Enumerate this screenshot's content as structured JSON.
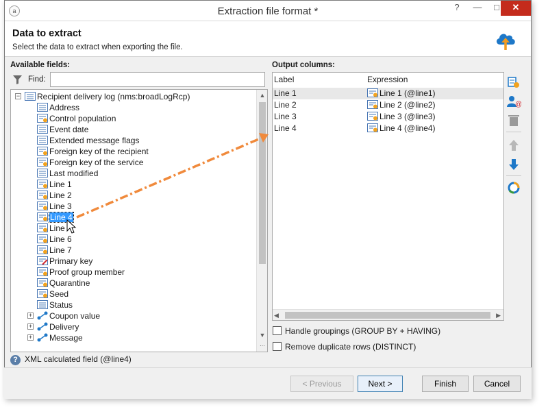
{
  "window": {
    "title": "Extraction file format *",
    "help_btn": "?",
    "close_btn": "✕"
  },
  "header": {
    "title": "Data to extract",
    "subtitle": "Select the data to extract when exporting the file.",
    "icon": "cloud-upload-icon"
  },
  "available": {
    "label": "Available fields:",
    "find_label": "Find:",
    "find_value": "",
    "tree": {
      "root": "Recipient delivery log (nms:broadLogRcp)",
      "fields": [
        "Address",
        "Control population",
        "Event date",
        "Extended message flags",
        "Foreign key of the recipient",
        "Foreign key of the service",
        "Last modified",
        "Line 1",
        "Line 2",
        "Line 3",
        "Line 4",
        "Line 5",
        "Line 6",
        "Line 7",
        "Primary key",
        "Proof group member",
        "Quarantine",
        "Seed",
        "Status"
      ],
      "links": [
        "Coupon value",
        "Delivery",
        "Message"
      ],
      "selected": "Line 4",
      "cursor_obscured_text": "Line"
    }
  },
  "output": {
    "label": "Output columns:",
    "columns": [
      "Label",
      "Expression"
    ],
    "rows": [
      {
        "label": "Line 1",
        "expression": "Line 1 (@line1)"
      },
      {
        "label": "Line 2",
        "expression": "Line 2 (@line2)"
      },
      {
        "label": "Line 3",
        "expression": "Line 3 (@line3)"
      },
      {
        "label": "Line 4",
        "expression": "Line 4 (@line4)"
      }
    ]
  },
  "options": {
    "grouping_label": "Handle groupings (GROUP BY + HAVING)",
    "grouping_checked": false,
    "distinct_label": "Remove duplicate rows (DISTINCT)",
    "distinct_checked": false
  },
  "status": {
    "text": "XML calculated field (@line4)"
  },
  "buttons": {
    "previous": "< Previous",
    "next": "Next >",
    "finish": "Finish",
    "cancel": "Cancel"
  },
  "colors": {
    "selection": "#3399ff",
    "drag_arrow": "#f08a3c",
    "accent_blue": "#1e78c8",
    "close_red": "#c42b1c"
  }
}
